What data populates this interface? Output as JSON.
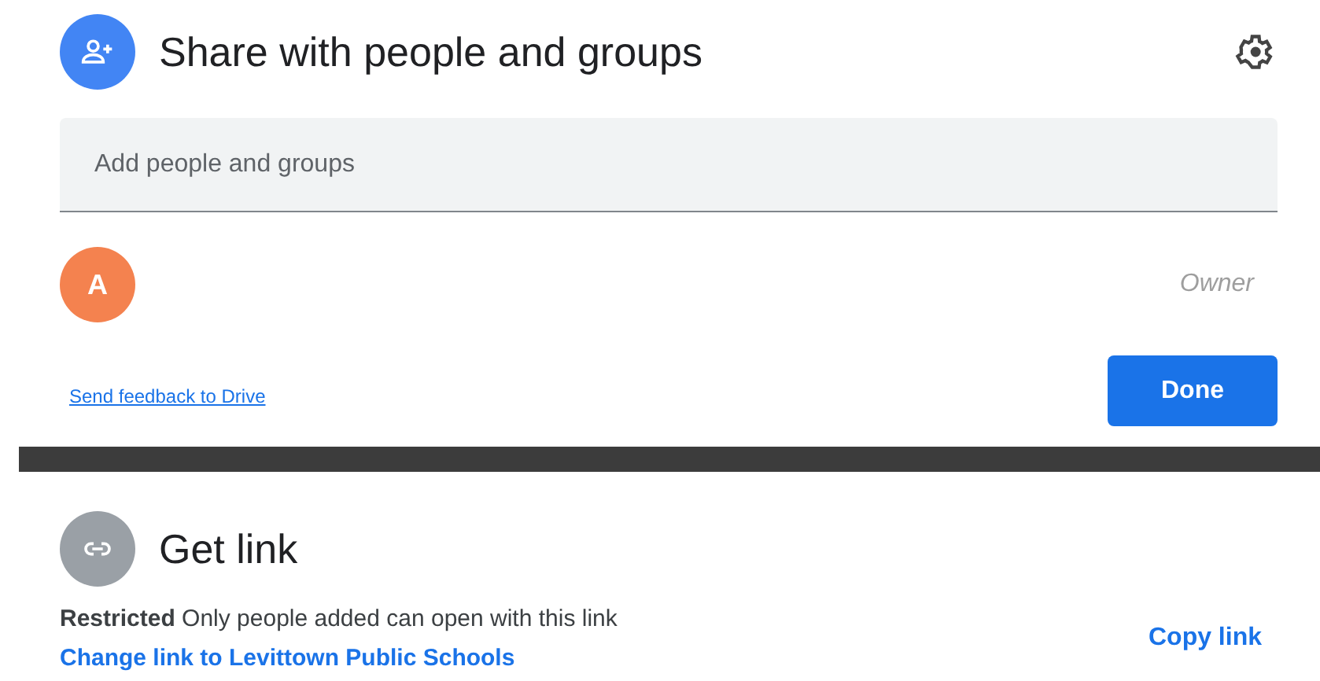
{
  "share": {
    "title": "Share with people and groups",
    "search": {
      "placeholder": "Add people and groups"
    },
    "people": [
      {
        "initial": "A",
        "color": "#f4824f",
        "role": "Owner"
      }
    ],
    "feedback_link": "Send feedback to Drive",
    "done_button": "Done"
  },
  "get_link": {
    "title": "Get link",
    "description": "**Restricted** Only people added can open with this link",
    "change_link": "Change link to Levittown Public Schools",
    "copy_link": "Copy link"
  }
}
